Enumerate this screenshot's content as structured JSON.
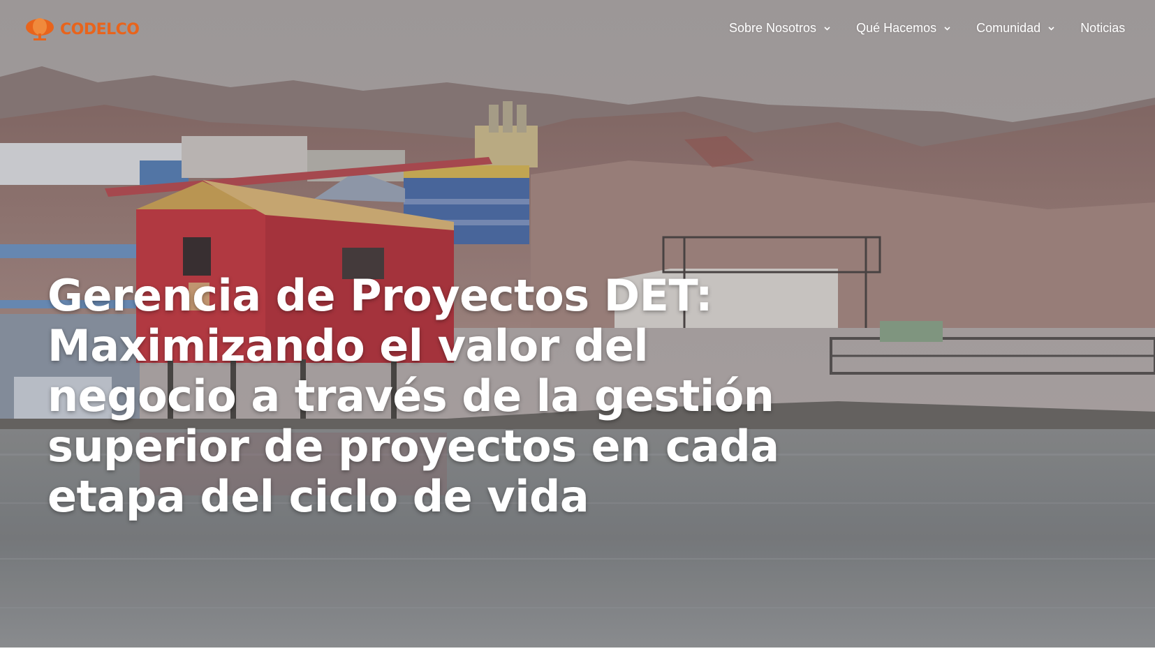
{
  "brand": {
    "logo_text": "CODELCO",
    "logo_icon": "codelco-copper-drop-icon",
    "color": "#e8641c"
  },
  "nav": {
    "items": [
      {
        "label": "Sobre Nosotros",
        "icon": "chevron-down-icon"
      },
      {
        "label": "Qué Hacemos",
        "icon": "chevron-down-icon"
      },
      {
        "label": "Comunidad",
        "icon": "chevron-down-icon"
      },
      {
        "label": "Noticias"
      }
    ]
  },
  "hero": {
    "headline_lines": [
      "Gerencia de Proyectos DET:",
      "Maximizando el valor del",
      "negocio a través de la gestión",
      "superior de proyectos en cada",
      "etapa del ciclo de vida"
    ]
  }
}
